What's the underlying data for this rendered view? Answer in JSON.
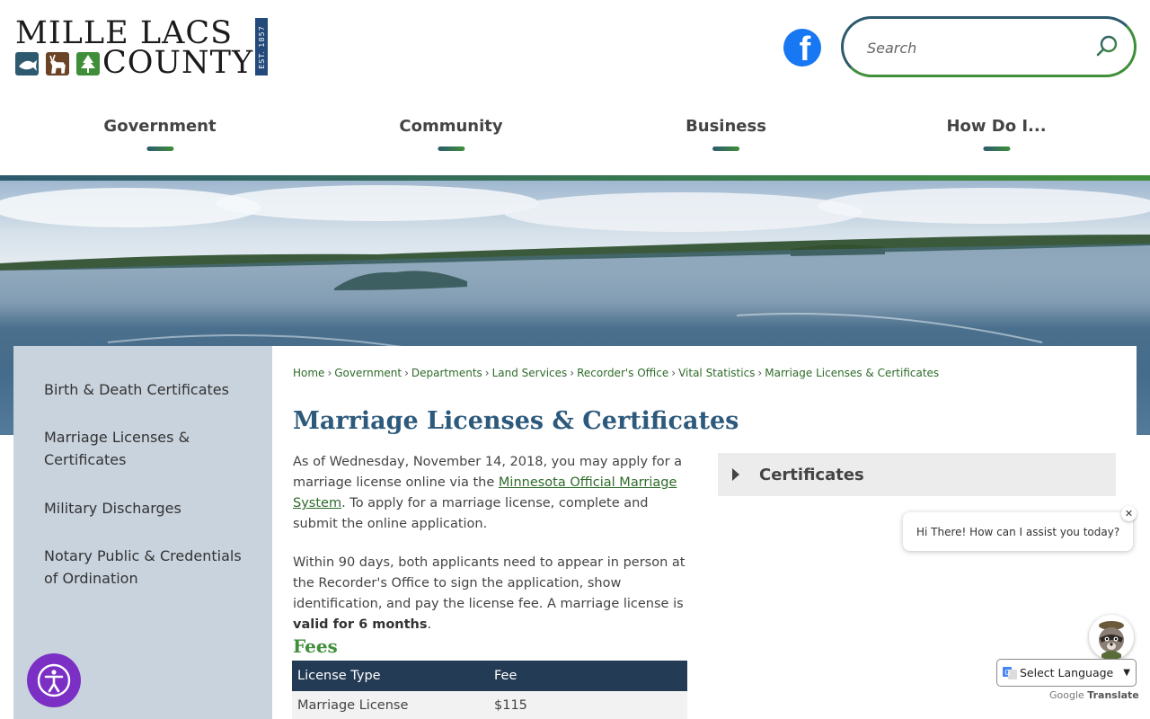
{
  "header": {
    "logo": {
      "line1": "MILLE LACS",
      "line2": "COUNTY",
      "established": "EST. 1857"
    },
    "search": {
      "placeholder": "Search"
    },
    "nav": [
      {
        "label": "Government"
      },
      {
        "label": "Community"
      },
      {
        "label": "Business"
      },
      {
        "label": "How Do I..."
      }
    ]
  },
  "sidebar": {
    "items": [
      {
        "label": "Birth & Death Certificates"
      },
      {
        "label": "Marriage Licenses & Certificates"
      },
      {
        "label": "Military Discharges"
      },
      {
        "label": "Notary Public & Credentials of Ordination"
      }
    ]
  },
  "main": {
    "breadcrumb": [
      "Home",
      "Government",
      "Departments",
      "Land Services",
      "Recorder's Office",
      "Vital Statistics",
      "Marriage Licenses & Certificates"
    ],
    "title": "Marriage Licenses & Certificates",
    "para1_before": "As of Wednesday, November 14, 2018, you may apply for a marriage license online via the ",
    "para1_link": "Minnesota Official Marriage System",
    "para1_after": ". To apply for a marriage license, complete and submit the online application.",
    "para2_before": "Within 90 days, both applicants need to appear in person at the Recorder's Office to sign the application, show identification, and pay the license fee. A marriage license is ",
    "para2_bold": "valid for 6 months",
    "para2_after": ".",
    "fees_heading": "Fees",
    "fees_table": {
      "headers": [
        "License Type",
        "Fee"
      ],
      "rows": [
        [
          "Marriage License",
          "$115"
        ]
      ]
    },
    "accordion_label": "Certificates"
  },
  "chat": {
    "message": "Hi There! How can I assist you today?",
    "close": "✕"
  },
  "translate": {
    "select_label": "Select Language",
    "powered_prefix": "Google",
    "powered_suffix": "Translate"
  },
  "colors": {
    "nav_accent_start": "#2d5a6e",
    "nav_accent_end": "#3f8f3a",
    "title": "#2d5a7c",
    "link": "#2e6b2a",
    "table_header": "#243b55",
    "a11y": "#7b2fc5"
  }
}
